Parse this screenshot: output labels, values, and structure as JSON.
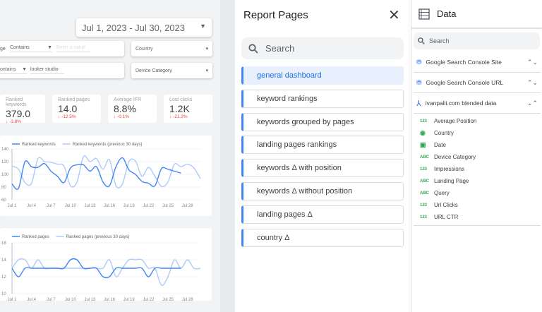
{
  "canvas": {
    "date_range": "Jul 1, 2023 - Jul 30, 2023",
    "filters": [
      {
        "label_fragment": "ge",
        "operator": "Contains",
        "placeholder": "Enter a value",
        "value": ""
      },
      {
        "operator": "ontains",
        "value": "looker studio"
      }
    ],
    "dropdowns": [
      "Country",
      "Device Category"
    ],
    "kpis": [
      {
        "label": "Ranked keywords",
        "value": "379.0",
        "delta": "-3.8%"
      },
      {
        "label": "Ranked pages",
        "value": "14.0",
        "delta": "-12.5%"
      },
      {
        "label": "Average IFR",
        "value": "8.8%",
        "delta": "-0.1%"
      },
      {
        "label": "Lost clicks",
        "value": "1.2K",
        "delta": "-21.2%"
      }
    ]
  },
  "chart_data": [
    {
      "type": "line",
      "xlabel": "",
      "ylabel": "",
      "ylim": [
        60,
        140
      ],
      "yticks": [
        60,
        80,
        100,
        120,
        140
      ],
      "xticks": [
        "Jul 1",
        "Jul 4",
        "Jul 7",
        "Jul 10",
        "Jul 13",
        "Jul 16",
        "Jul 19",
        "Jul 22",
        "Jul 25",
        "Jul 28"
      ],
      "grid": true,
      "legend": "top-left",
      "series": [
        {
          "name": "Ranked keywords",
          "color": "#4285f4",
          "values": [
            85,
            78,
            120,
            112,
            111,
            117,
            105,
            97,
            87,
            110,
            115,
            115,
            105,
            112,
            88,
            82,
            112,
            126,
            107,
            100,
            89,
            86,
            82,
            109,
            108,
            105,
            102
          ]
        },
        {
          "name": "Ranked keywords (previous 30 days)",
          "color": "#aecbfa",
          "values": [
            113,
            108,
            87,
            86,
            125,
            120,
            119,
            116,
            113,
            82,
            88,
            128,
            120,
            125,
            108,
            123,
            82,
            85,
            120,
            121,
            97,
            111,
            97,
            81,
            88,
            116,
            112,
            116,
            110,
            93
          ]
        }
      ]
    },
    {
      "type": "line",
      "xlabel": "",
      "ylabel": "",
      "ylim": [
        10,
        16
      ],
      "yticks": [
        10,
        12,
        14,
        16
      ],
      "xticks": [
        "Jul 1",
        "Jul 4",
        "Jul 7",
        "Jul 10",
        "Jul 13",
        "Jul 16",
        "Jul 19",
        "Jul 22",
        "Jul 25",
        "Jul 28"
      ],
      "grid": true,
      "legend": "top-left",
      "series": [
        {
          "name": "Ranked pages",
          "color": "#4285f4",
          "values": [
            13,
            12,
            13,
            13,
            13,
            13,
            13,
            13,
            13,
            14,
            14,
            13,
            13,
            13,
            12,
            12,
            13,
            13,
            13,
            13,
            13,
            12,
            13,
            13,
            13,
            13,
            13
          ]
        },
        {
          "name": "Ranked pages (previous 30 days)",
          "color": "#aecbfa",
          "values": [
            13,
            14,
            14,
            13,
            14,
            13,
            13,
            13,
            13,
            13,
            13,
            13,
            13,
            13,
            13,
            14,
            12,
            13,
            14,
            14,
            14,
            13,
            13,
            11,
            12,
            14,
            13,
            14,
            13,
            13
          ]
        }
      ]
    }
  ],
  "report_pages": {
    "title": "Report Pages",
    "close_icon": "close-icon",
    "search_placeholder": "Search",
    "accent": "#4285f4",
    "pages": [
      "general dashboard",
      "keyword rankings",
      "keywords grouped by pages",
      "landing pages rankings",
      "keywords Δ with position",
      "keywords Δ without position",
      "landing pages Δ",
      "country Δ"
    ],
    "active_index": 0
  },
  "data_panel": {
    "title": "Data",
    "search_placeholder": "Search",
    "sources": [
      "Google Search Console Site",
      "Google Search Console URL",
      "ivanpalii.com blended data"
    ],
    "fields": [
      {
        "type": "123",
        "name": "Average Position"
      },
      {
        "type": "globe",
        "name": "Country"
      },
      {
        "type": "calendar",
        "name": "Date"
      },
      {
        "type": "ABC",
        "name": "Device Category"
      },
      {
        "type": "123",
        "name": "Impressions"
      },
      {
        "type": "ABC",
        "name": "Landing Page"
      },
      {
        "type": "ABC",
        "name": "Query"
      },
      {
        "type": "123",
        "name": "Url Clicks"
      },
      {
        "type": "123",
        "name": "URL CTR"
      }
    ]
  }
}
